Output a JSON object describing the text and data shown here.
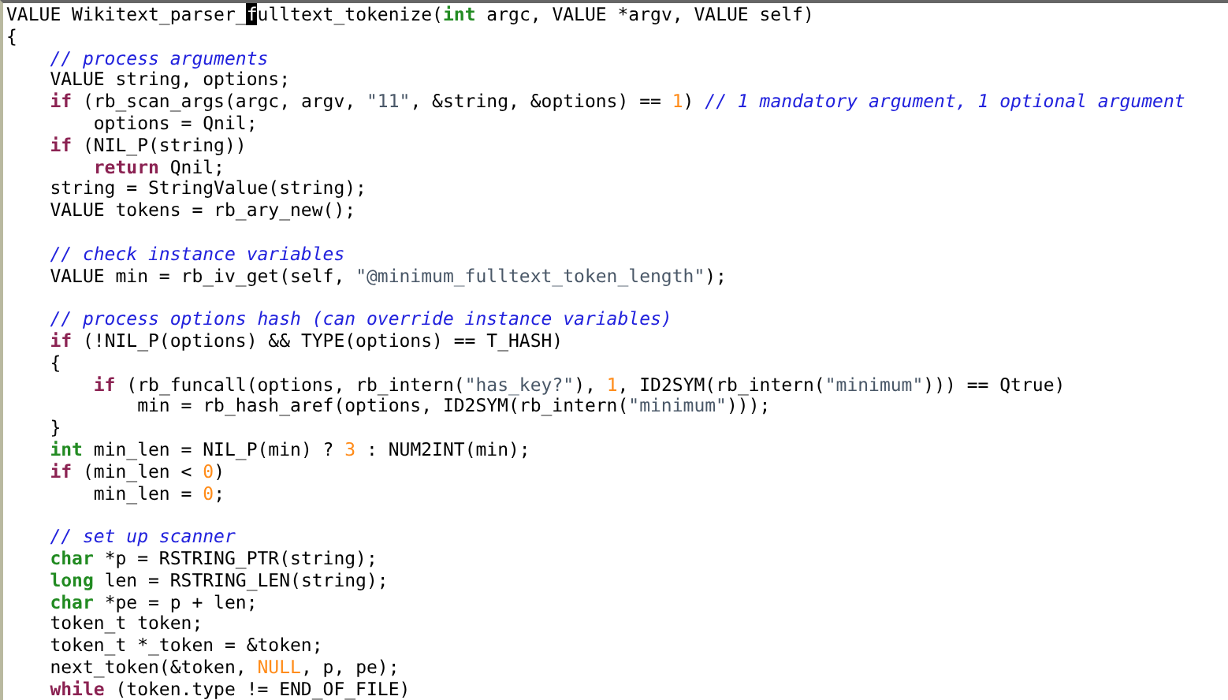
{
  "editor": {
    "lines": [
      {
        "kind": "code",
        "tokens": [
          {
            "kind": "plain",
            "text": "VALUE Wikitext_parser_"
          },
          {
            "kind": "cursor",
            "text": "f"
          },
          {
            "kind": "plain",
            "text": "ulltext_tokenize("
          },
          {
            "kind": "type",
            "text": "int"
          },
          {
            "kind": "plain",
            "text": " argc, VALUE *argv, VALUE self)"
          }
        ]
      },
      {
        "kind": "code",
        "tokens": [
          {
            "kind": "plain",
            "text": "{"
          }
        ]
      },
      {
        "kind": "code",
        "tokens": [
          {
            "kind": "comment",
            "text": "    // process arguments"
          }
        ]
      },
      {
        "kind": "code",
        "tokens": [
          {
            "kind": "plain",
            "text": "    VALUE string, options;"
          }
        ]
      },
      {
        "kind": "code",
        "tokens": [
          {
            "kind": "keyword",
            "text": "    if"
          },
          {
            "kind": "plain",
            "text": " (rb_scan_args(argc, argv, "
          },
          {
            "kind": "string",
            "text": "\"11\""
          },
          {
            "kind": "plain",
            "text": ", &string, &options) == "
          },
          {
            "kind": "number",
            "text": "1"
          },
          {
            "kind": "plain",
            "text": ") "
          },
          {
            "kind": "comment",
            "text": "// 1 mandatory argument, 1 optional argument"
          }
        ]
      },
      {
        "kind": "code",
        "tokens": [
          {
            "kind": "plain",
            "text": "        options = Qnil;"
          }
        ]
      },
      {
        "kind": "code",
        "tokens": [
          {
            "kind": "keyword",
            "text": "    if"
          },
          {
            "kind": "plain",
            "text": " (NIL_P(string))"
          }
        ]
      },
      {
        "kind": "code",
        "tokens": [
          {
            "kind": "keyword",
            "text": "        return"
          },
          {
            "kind": "plain",
            "text": " Qnil;"
          }
        ]
      },
      {
        "kind": "code",
        "tokens": [
          {
            "kind": "plain",
            "text": "    string = StringValue(string);"
          }
        ]
      },
      {
        "kind": "code",
        "tokens": [
          {
            "kind": "plain",
            "text": "    VALUE tokens = rb_ary_new();"
          }
        ]
      },
      {
        "kind": "blank"
      },
      {
        "kind": "code",
        "tokens": [
          {
            "kind": "comment",
            "text": "    // check instance variables"
          }
        ]
      },
      {
        "kind": "code",
        "tokens": [
          {
            "kind": "plain",
            "text": "    VALUE min = rb_iv_get(self, "
          },
          {
            "kind": "string",
            "text": "\"@minimum_fulltext_token_length\""
          },
          {
            "kind": "plain",
            "text": ");"
          }
        ]
      },
      {
        "kind": "blank"
      },
      {
        "kind": "code",
        "tokens": [
          {
            "kind": "comment",
            "text": "    // process options hash (can override instance variables)"
          }
        ]
      },
      {
        "kind": "code",
        "tokens": [
          {
            "kind": "keyword",
            "text": "    if"
          },
          {
            "kind": "plain",
            "text": " (!NIL_P(options) && TYPE(options) == T_HASH)"
          }
        ]
      },
      {
        "kind": "code",
        "tokens": [
          {
            "kind": "plain",
            "text": "    {"
          }
        ]
      },
      {
        "kind": "code",
        "tokens": [
          {
            "kind": "keyword",
            "text": "        if"
          },
          {
            "kind": "plain",
            "text": " (rb_funcall(options, rb_intern("
          },
          {
            "kind": "string",
            "text": "\"has_key?\""
          },
          {
            "kind": "plain",
            "text": "), "
          },
          {
            "kind": "number",
            "text": "1"
          },
          {
            "kind": "plain",
            "text": ", ID2SYM(rb_intern("
          },
          {
            "kind": "string",
            "text": "\"minimum\""
          },
          {
            "kind": "plain",
            "text": "))) == Qtrue)"
          }
        ]
      },
      {
        "kind": "code",
        "tokens": [
          {
            "kind": "plain",
            "text": "            min = rb_hash_aref(options, ID2SYM(rb_intern("
          },
          {
            "kind": "string",
            "text": "\"minimum\""
          },
          {
            "kind": "plain",
            "text": ")));"
          }
        ]
      },
      {
        "kind": "code",
        "tokens": [
          {
            "kind": "plain",
            "text": "    }"
          }
        ]
      },
      {
        "kind": "code",
        "tokens": [
          {
            "kind": "type",
            "text": "    int"
          },
          {
            "kind": "plain",
            "text": " min_len = NIL_P(min) ? "
          },
          {
            "kind": "number",
            "text": "3"
          },
          {
            "kind": "plain",
            "text": " : NUM2INT(min);"
          }
        ]
      },
      {
        "kind": "code",
        "tokens": [
          {
            "kind": "keyword",
            "text": "    if"
          },
          {
            "kind": "plain",
            "text": " (min_len < "
          },
          {
            "kind": "number",
            "text": "0"
          },
          {
            "kind": "plain",
            "text": ")"
          }
        ]
      },
      {
        "kind": "code",
        "tokens": [
          {
            "kind": "plain",
            "text": "        min_len = "
          },
          {
            "kind": "number",
            "text": "0"
          },
          {
            "kind": "plain",
            "text": ";"
          }
        ]
      },
      {
        "kind": "blank"
      },
      {
        "kind": "code",
        "tokens": [
          {
            "kind": "comment",
            "text": "    // set up scanner"
          }
        ]
      },
      {
        "kind": "code",
        "tokens": [
          {
            "kind": "type",
            "text": "    char"
          },
          {
            "kind": "plain",
            "text": " *p = RSTRING_PTR(string);"
          }
        ]
      },
      {
        "kind": "code",
        "tokens": [
          {
            "kind": "type",
            "text": "    long"
          },
          {
            "kind": "plain",
            "text": " len = RSTRING_LEN(string);"
          }
        ]
      },
      {
        "kind": "code",
        "tokens": [
          {
            "kind": "type",
            "text": "    char"
          },
          {
            "kind": "plain",
            "text": " *pe = p + len;"
          }
        ]
      },
      {
        "kind": "code",
        "tokens": [
          {
            "kind": "plain",
            "text": "    token_t token;"
          }
        ]
      },
      {
        "kind": "code",
        "tokens": [
          {
            "kind": "plain",
            "text": "    token_t *_token = &token;"
          }
        ]
      },
      {
        "kind": "code",
        "tokens": [
          {
            "kind": "plain",
            "text": "    next_token(&token, "
          },
          {
            "kind": "number",
            "text": "NULL"
          },
          {
            "kind": "plain",
            "text": ", p, pe);"
          }
        ]
      },
      {
        "kind": "code",
        "tokens": [
          {
            "kind": "keyword",
            "text": "    while"
          },
          {
            "kind": "plain",
            "text": " (token.type != END_OF_FILE)"
          }
        ]
      }
    ]
  }
}
